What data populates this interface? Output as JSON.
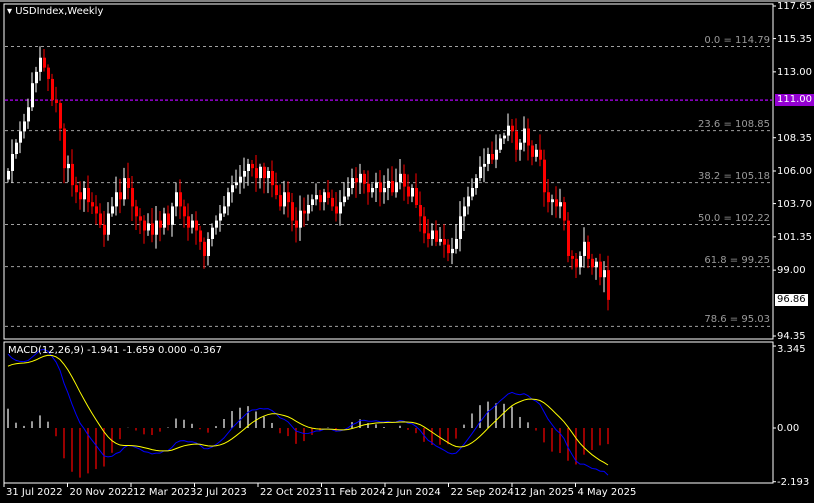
{
  "chart_title": "USDIndex,Weekly",
  "macd_title": "MACD(12,26,9) -1.941 -1.659 0.000 -0.367",
  "current_price": "96.86",
  "alert_line": "111.00",
  "price_axis": [
    "117.65",
    "115.35",
    "113.00",
    "108.35",
    "106.00",
    "103.70",
    "101.35",
    "99.00",
    "94.35"
  ],
  "price_axis_values": [
    117.65,
    115.35,
    113.0,
    108.35,
    106.0,
    103.7,
    101.35,
    99.0,
    94.35
  ],
  "macd_axis": [
    "3.345",
    "0.00",
    "-2.193"
  ],
  "fibonacci": [
    {
      "label": "0.0 = 114.79",
      "value": 114.79
    },
    {
      "label": "23.6 = 108.85",
      "value": 108.85
    },
    {
      "label": "38.2 = 105.18",
      "value": 105.18
    },
    {
      "label": "50.0 = 102.22",
      "value": 102.22
    },
    {
      "label": "61.8 = 99.25",
      "value": 99.25
    },
    {
      "label": "78.6 = 95.03",
      "value": 95.03
    }
  ],
  "time_axis": [
    "31 Jul 2022",
    "20 Nov 2022",
    "12 Mar 2023",
    "2 Jul 2023",
    "22 Oct 2023",
    "11 Feb 2024",
    "2 Jun 2024",
    "22 Sep 2024",
    "12 Jan 2025",
    "4 May 2025"
  ],
  "colors": {
    "up": "#ffffff",
    "down": "#ff0000",
    "alert": "#9400d3",
    "fib": "#a0a0a0",
    "macd": "#0000ff",
    "signal": "#ffff00"
  },
  "chart_data": {
    "type": "candlestick",
    "title": "USDIndex,Weekly",
    "ylim": [
      94.35,
      117.65
    ],
    "macd_ylim": [
      -2.193,
      3.345
    ],
    "closes": [
      106,
      107.2,
      108,
      108.8,
      109.5,
      110.5,
      112.2,
      113,
      114,
      113.3,
      112.5,
      111,
      110.8,
      109,
      106.2,
      106.5,
      105,
      104.5,
      104,
      104.8,
      103.8,
      103.5,
      103,
      102.2,
      101.5,
      103,
      103.5,
      104.5,
      104,
      105.5,
      104.8,
      103.5,
      102.8,
      102.5,
      101.8,
      102.3,
      101.5,
      102.5,
      102,
      103,
      102.2,
      103.5,
      104.5,
      103.5,
      102.8,
      102,
      102.5,
      101.8,
      101,
      100,
      101.2,
      102,
      102.5,
      103,
      103.5,
      104.5,
      105,
      105.2,
      105.6,
      106,
      106.5,
      106.2,
      105.5,
      106.3,
      105.5,
      106,
      105,
      104.3,
      103.5,
      104.5,
      103.8,
      102.5,
      102,
      103.2,
      103,
      103.6,
      104,
      104.3,
      103.8,
      104.5,
      104.1,
      103.5,
      103,
      103.8,
      104.2,
      104.8,
      105.5,
      105.2,
      105.8,
      105.1,
      104.5,
      104.8,
      105.2,
      104.5,
      104.8,
      105.3,
      104.5,
      105.2,
      105.8,
      104.9,
      104.2,
      104.8,
      103.6,
      102.8,
      101.6,
      101.2,
      101.8,
      101,
      101.2,
      100.8,
      100.2,
      100.5,
      101.2,
      102.8,
      103.5,
      104.2,
      104.8,
      105.5,
      106.3,
      106.5,
      107.2,
      106.8,
      107.5,
      108.3,
      108.5,
      109.2,
      108.8,
      107.5,
      108,
      109,
      107.8,
      107,
      107.5,
      106.8,
      104.5,
      103.8,
      104,
      103.5,
      103.8,
      102.5,
      100,
      99.8,
      99.2,
      100,
      101,
      99.8,
      99.2,
      99.6,
      98.5,
      99,
      96.9
    ]
  }
}
